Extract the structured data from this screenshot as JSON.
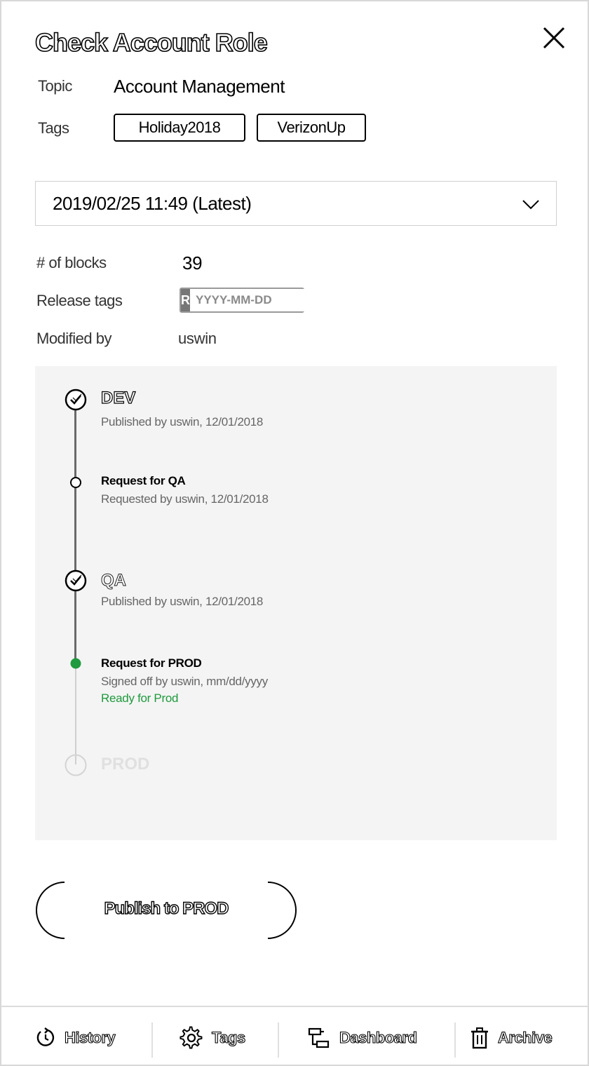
{
  "header": {
    "title": "Check Account Role"
  },
  "topic": {
    "label": "Topic",
    "value": "Account Management"
  },
  "tags": {
    "label": "Tags",
    "items": [
      "Holiday2018",
      "VerizonUp"
    ]
  },
  "version_select": {
    "selected": "2019/02/25 11:49 (Latest)"
  },
  "info": {
    "blocks_label": "# of blocks",
    "blocks_value": "39",
    "release_label": "Release tags",
    "release_badge": "R",
    "release_placeholder": "YYYY-MM-DD",
    "modified_label": "Modified by",
    "modified_value": "uswin"
  },
  "timeline": {
    "steps": [
      {
        "title": "DEV",
        "sub": "Published by uswin, 12/01/2018"
      },
      {
        "title": "Request for QA",
        "sub": "Requested by uswin, 12/01/2018"
      },
      {
        "title": "QA",
        "sub": "Published by uswin, 12/01/2018"
      },
      {
        "title": "Request for  PROD",
        "sub": "Signed off by uswin, mm/dd/yyyy",
        "status": "Ready for Prod"
      },
      {
        "title": "PROD"
      }
    ]
  },
  "actions": {
    "publish_label": "Publish to PROD"
  },
  "footer": {
    "history": "History",
    "tags": "Tags",
    "dashboard": "Dashboard",
    "archive": "Archive"
  },
  "colors": {
    "accent_green": "#1f9a3e",
    "panel_gray": "#f4f4f4"
  }
}
